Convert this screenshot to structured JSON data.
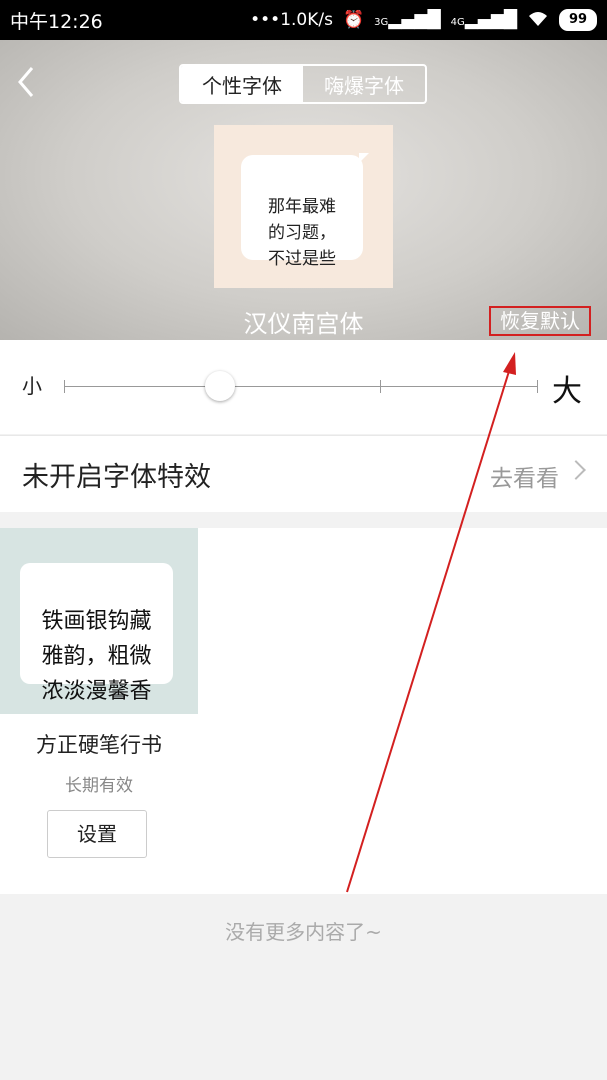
{
  "status_bar": {
    "time": "中午12:26",
    "network_speed": "1.0K/s",
    "alarm_icon": "alarm-icon",
    "signal_1": "3G",
    "signal_2": "4G",
    "battery": "99"
  },
  "header": {
    "back_icon": "chevron-left-icon",
    "tabs": [
      {
        "label": "个性字体",
        "active": true
      },
      {
        "label": "嗨爆字体",
        "active": false
      }
    ]
  },
  "preview": {
    "bubble_text": "那年最难\n的习题，\n不过是些",
    "font_name": "汉仪南宫体",
    "restore_label": "恢复默认"
  },
  "size_slider": {
    "small_label": "小",
    "large_label": "大",
    "steps": 5,
    "current_step": 1
  },
  "effect_row": {
    "title": "未开启字体特效",
    "link_label": "去看看"
  },
  "font_list": [
    {
      "sample_text": "铁画银钩藏\n雅韵，粗微\n浓淡漫馨香",
      "name": "方正硬笔行书",
      "validity": "长期有效",
      "button_label": "设置"
    }
  ],
  "footer": {
    "no_more_text": "没有更多内容了~"
  },
  "colors": {
    "annotation_red": "#d32020",
    "preview_bg": "#f7e9dd",
    "card_bg": "#d7e4e2"
  }
}
